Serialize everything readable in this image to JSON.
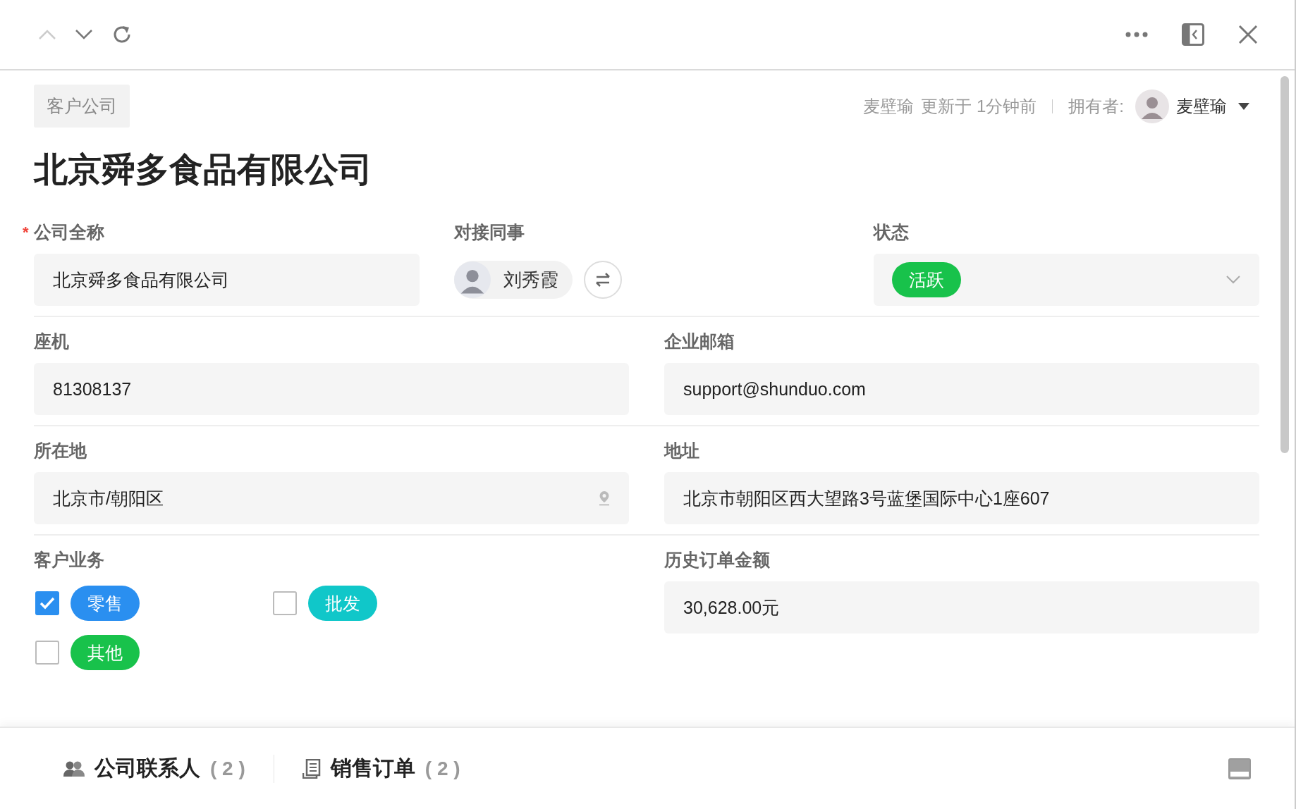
{
  "header": {
    "tag": "客户公司",
    "title": "北京舜多食品有限公司",
    "updated_by": "麦壁瑜",
    "updated_text": "更新于 1分钟前",
    "owner_label": "拥有者:",
    "owner_name": "麦壁瑜"
  },
  "rows": [
    [
      {
        "kind": "text",
        "label": "公司全称",
        "required_mark": "*",
        "value": "北京舜多食品有限公司"
      },
      {
        "kind": "colleague",
        "label": "对接同事",
        "name": "刘秀霞"
      },
      {
        "kind": "status",
        "label": "状态",
        "value": "活跃"
      }
    ],
    [
      {
        "kind": "text",
        "label": "座机",
        "value": "81308137"
      },
      {
        "kind": "text",
        "label": "企业邮箱",
        "value": "support@shunduo.com"
      }
    ],
    [
      {
        "kind": "location",
        "label": "所在地",
        "value": "北京市/朝阳区"
      },
      {
        "kind": "text",
        "label": "地址",
        "value": "北京市朝阳区西大望路3号蓝堡国际中心1座607"
      }
    ],
    [
      {
        "kind": "options",
        "label": "客户业务",
        "options": [
          {
            "label": "零售",
            "checked": true,
            "color": "#2a8ff0"
          },
          {
            "label": "批发",
            "checked": false,
            "color": "#10c7c9"
          },
          {
            "label": "其他",
            "checked": false,
            "color": "#18c24b"
          }
        ]
      },
      {
        "kind": "text",
        "label": "历史订单金额",
        "value": "30,628.00元"
      }
    ]
  ],
  "bottom_tabs": [
    {
      "kind": "contacts",
      "label": "公司联系人",
      "count": "( 2 )"
    },
    {
      "kind": "orders",
      "label": "销售订单",
      "count": "( 2 )"
    }
  ]
}
